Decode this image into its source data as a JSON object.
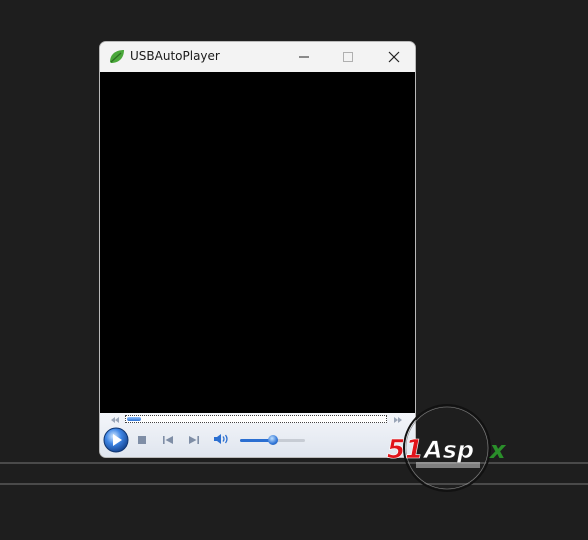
{
  "window": {
    "title": "USBAutoPlayer"
  },
  "titlebar": {
    "icon": "leaf-icon",
    "minimize_icon": "minimize-icon",
    "maximize_icon": "maximize-icon",
    "close_icon": "close-icon"
  },
  "player": {
    "seek_progress": 0.0,
    "volume_level": 0.5,
    "controls": [
      "play-icon",
      "stop-icon",
      "previous-icon",
      "next-icon",
      "volume-icon"
    ]
  },
  "watermark": {
    "text": "51Aspx",
    "colors": {
      "red": "#e0141b",
      "green": "#2a8f2a"
    }
  },
  "colors": {
    "desktop": "#1e1e1e",
    "titlebar": "#f3f3f3",
    "video": "#000000",
    "accent": "#2b6fd1"
  }
}
